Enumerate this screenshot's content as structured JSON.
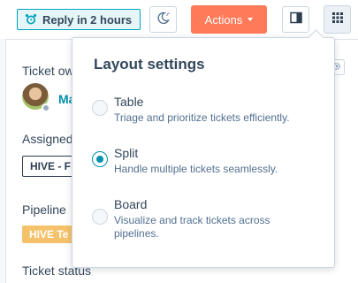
{
  "header": {
    "reply_badge": "Reply in 2 hours",
    "actions_label": "Actions"
  },
  "left_panel": {
    "ticket_owner_label": "Ticket ow",
    "owner_name": "Ma",
    "assigned_label": "Assigned",
    "team_tag": "HIVE - F",
    "pipeline_label": "Pipeline",
    "pipeline_tag": "HIVE Te",
    "ticket_status_label": "Ticket status"
  },
  "layout_settings": {
    "title": "Layout settings",
    "selected": "Split",
    "options": [
      {
        "label": "Table",
        "description": "Triage and prioritize tickets efficiently."
      },
      {
        "label": "Split",
        "description": "Handle multiple tickets seamlessly."
      },
      {
        "label": "Board",
        "description": "Visualize and track tickets across pipelines."
      }
    ]
  },
  "colors": {
    "accent": "#ff7a59",
    "teal": "#0091ae",
    "badge_border": "#00a4bd",
    "pipeline_tag": "#f5c26b"
  },
  "icons": [
    "alarm-clock-icon",
    "snooze-moon-icon",
    "caret-down-icon",
    "sidebar-panel-icon",
    "grid-apps-icon",
    "settings-gear-icon"
  ]
}
